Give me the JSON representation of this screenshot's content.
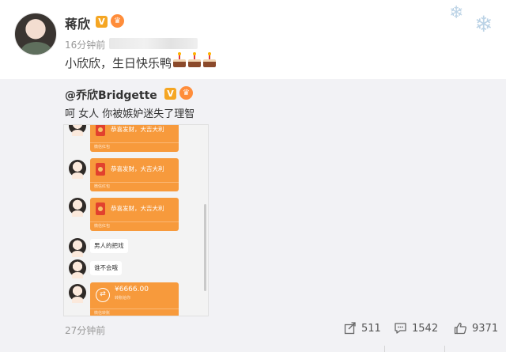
{
  "post": {
    "author": "蒋欣",
    "time": "16分钟前",
    "text": "小欣欣，生日快乐鸭",
    "cake_count": 3
  },
  "repost": {
    "author": "@乔欣Bridgette",
    "text": "呵 女人 你被嫉妒迷失了理智",
    "chat": {
      "red_packet_wish": "恭喜发财，大吉大利",
      "red_packet_footer": "微信红包",
      "bubble_1": "男人的把戏",
      "bubble_2": "谁不会哦",
      "transfer_amount": "¥6666.00",
      "transfer_sub": "转账给你",
      "transfer_footer": "微信转账"
    }
  },
  "footer": {
    "time": "27分钟前",
    "share_count": "511",
    "comment_count": "1542",
    "like_count": "9371"
  },
  "icons": {
    "verified": "verified-v-icon",
    "member": "member-crown-icon",
    "share": "share-icon",
    "comment": "comment-icon",
    "like": "thumbs-up-icon"
  },
  "colors": {
    "verified": "#f5a623",
    "transfer_orange": "#f79a3c",
    "repost_bg": "#f2f2f5"
  }
}
